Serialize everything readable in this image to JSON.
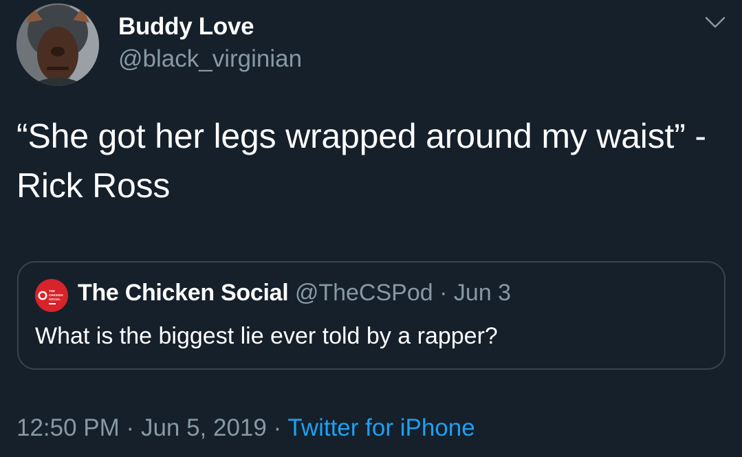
{
  "author": {
    "display_name": "Buddy Love",
    "handle": "@black_virginian"
  },
  "tweet": {
    "text": "“She got her legs wrapped around my waist” -Rick Ross"
  },
  "quoted_tweet": {
    "display_name": "The Chicken Social",
    "handle": "@TheCSPod",
    "separator": "·",
    "date": "Jun 3",
    "text": "What is the biggest lie ever told by a rapper?",
    "avatar_lines": [
      "THE",
      "CHICKEN",
      "SOCIAL"
    ]
  },
  "meta": {
    "time": "12:50 PM",
    "separator_1": "·",
    "date": "Jun 5, 2019",
    "separator_2": "·",
    "source": "Twitter for iPhone"
  },
  "icons": {
    "menu": "chevron-down-icon"
  },
  "colors": {
    "background": "#15202b",
    "primary_text": "#ffffff",
    "secondary_text": "#8899a6",
    "link": "#1da1f2",
    "border": "#38444d",
    "quoted_avatar": "#d8232a"
  }
}
